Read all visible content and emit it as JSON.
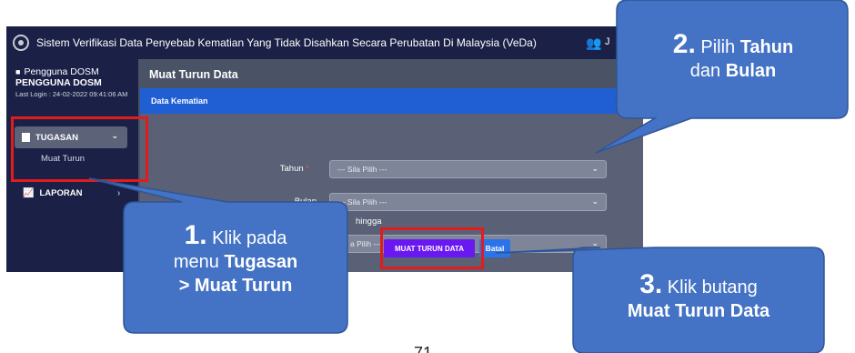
{
  "topbar": {
    "title": "Sistem Verifikasi Data Penyebab Kematian Yang Tidak Disahkan Secara Perubatan Di Malaysia (VeDa)",
    "user_initial": "J",
    "logo_icon": "circle-logo-icon",
    "user_icon": "users-icon"
  },
  "sidebar": {
    "user_label": "Pengguna DOSM",
    "user_name": "PENGGUNA DOSM",
    "last_login": "Last Login : 24-02-2022 09:41:06 AM",
    "menu_tugasan": "TUGASAN",
    "submenu_muat": "Muat Turun",
    "menu_laporan": "LAPORAN"
  },
  "main": {
    "page_title": "Muat Turun Data",
    "panel_title": "Data Kematian",
    "tahun_label": "Tahun",
    "required_mark": "*",
    "tahun_value": "--- Sila Pilih ---",
    "bulan_label": "Bulan",
    "bulan_value": "--- Sila Pilih ---",
    "hingga_label": "hingga",
    "bulan_to_value": "a Pilih ---",
    "btn_muat": "MUAT TURUN DATA",
    "btn_batal": "Batal"
  },
  "callouts": {
    "c1_num": "1.",
    "c1_pre": " Klik pada",
    "c1_line2_pre": "menu ",
    "c1_line2_bold": "Tugasan",
    "c1_line3": "> Muat Turun",
    "c2_num": "2.",
    "c2_pre": " Pilih ",
    "c2_bold1": "Tahun",
    "c2_mid": "dan ",
    "c2_bold2": "Bulan",
    "c3_num": "3.",
    "c3_pre": " Klik butang",
    "c3_bold": "Muat Turun Data",
    "fill_color": "#4472c4",
    "border_color": "#2f5597"
  },
  "page_number": "71"
}
